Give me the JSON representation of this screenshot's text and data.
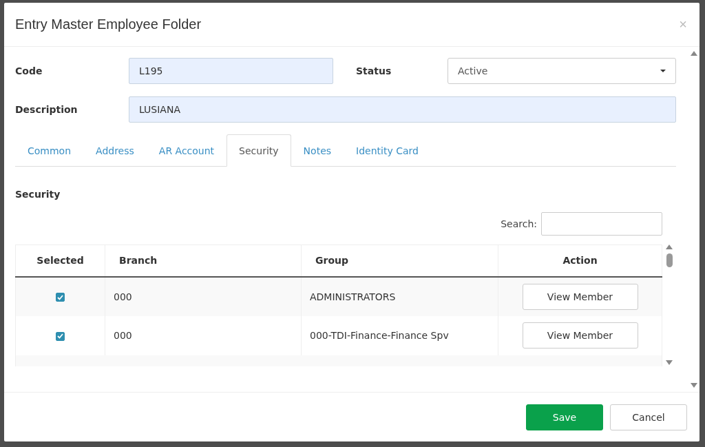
{
  "dialog": {
    "title": "Entry Master Employee Folder",
    "close": "×"
  },
  "fields": [
    {
      "label": "Code",
      "value": "L195"
    },
    {
      "label": "Status",
      "value": "Active"
    },
    {
      "label": "Description",
      "value": "LUSIANA"
    }
  ],
  "tabs": [
    {
      "label": "Common",
      "selected": false
    },
    {
      "label": "Address",
      "selected": false
    },
    {
      "label": "AR Account",
      "selected": false
    },
    {
      "label": "Security",
      "selected": true
    },
    {
      "label": "Notes",
      "selected": false
    },
    {
      "label": "Identity Card",
      "selected": false
    }
  ],
  "section_title": "Security",
  "search": {
    "label": "Search:"
  },
  "table": {
    "columns": [
      "Selected",
      "Branch",
      "Group",
      "Action"
    ],
    "rows": [
      {
        "checked": true,
        "branch": "000",
        "group": "ADMINISTRATORS",
        "action": "View Member"
      },
      {
        "checked": true,
        "branch": "000",
        "group": "000-TDI-Finance-Finance Spv",
        "action": "View Member"
      }
    ]
  },
  "buttons": [
    {
      "label": "Save",
      "kind": "primary"
    },
    {
      "label": "Cancel",
      "kind": "secondary"
    }
  ]
}
